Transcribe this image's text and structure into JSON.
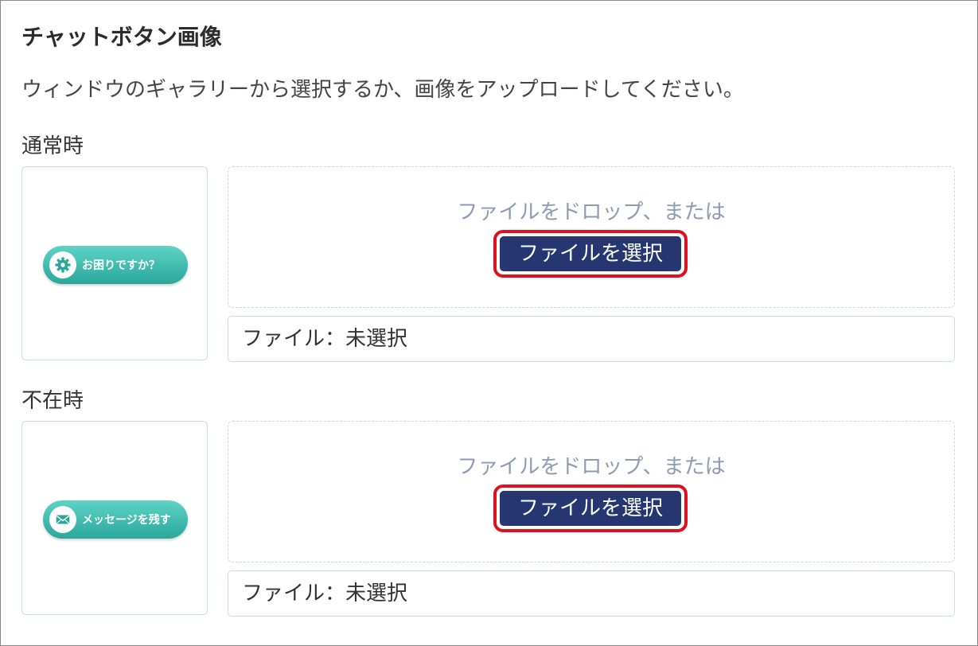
{
  "section": {
    "title": "チャットボタン画像",
    "description": "ウィンドウのギャラリーから選択するか、画像をアップロードしてください。"
  },
  "images": [
    {
      "label": "通常時",
      "preview_button_text": "お困りですか？",
      "preview_icon": "gear-icon",
      "drop_text": "ファイルをドロップ、または",
      "select_button": "ファイルを選択",
      "file_status": "ファイル：未選択"
    },
    {
      "label": "不在時",
      "preview_button_text": "メッセージを残す",
      "preview_icon": "envelope-icon",
      "drop_text": "ファイルをドロップ、または",
      "select_button": "ファイルを選択",
      "file_status": "ファイル：未選択"
    }
  ],
  "colors": {
    "select_button_bg": "#253670",
    "highlight_outline": "#e0101f",
    "chat_button_gradient_top": "#5ed3c6",
    "chat_button_gradient_bottom": "#2aa79b",
    "drop_text": "#8e9ab6"
  }
}
